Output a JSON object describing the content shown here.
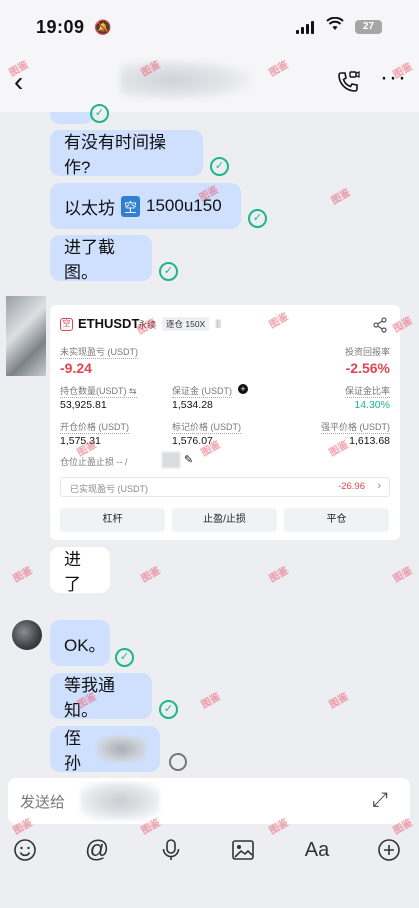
{
  "status_bar": {
    "time": "19:09",
    "battery": "27"
  },
  "header": {
    "back_icon": "chevron-left-icon",
    "call_icon": "video-call-icon",
    "more_icon": "more-icon"
  },
  "messages": {
    "m1": "有没有时间操作?",
    "m2_prefix": "以太坊",
    "m2_tag": "空",
    "m2_suffix": "1500u150",
    "m3": "进了截图。",
    "m4": "进了",
    "m5": "OK。",
    "m6": "等我通知。",
    "m7": "侄孙"
  },
  "trade_card": {
    "pair": "ETHUSDT",
    "type": "永续",
    "mode": "逐仓 150X",
    "bars": "||||",
    "unrealized_label": "未实现盈亏 (USDT)",
    "unrealized_value": "-9.24",
    "roi_label": "投资回报率",
    "roi_value": "-2.56%",
    "size_label": "持仓数量(USDT) ⇆",
    "size_value": "53,925.81",
    "margin_label": "保证金 (USDT)",
    "margin_value": "1,534.28",
    "margin_ratio_label": "保证金比率",
    "margin_ratio_value": "14.30%",
    "entry_label": "开仓价格 (USDT)",
    "entry_value": "1,575.31",
    "mark_label": "标记价格 (USDT)",
    "mark_value": "1,576.07",
    "liq_label": "强平价格 (USDT)",
    "liq_value": "1,613.68",
    "tpsl_label": "仓位止盈止损 -- /",
    "realized_label": "已实现盈亏 (USDT)",
    "realized_value": "-26.96",
    "btn_leverage": "杠杆",
    "btn_tpsl": "止盈/止损",
    "btn_close": "平仓"
  },
  "input": {
    "placeholder": "发送给"
  },
  "toolbar": {
    "emoji": "emoji-icon",
    "mention": "mention-icon",
    "voice": "microphone-icon",
    "image": "image-icon",
    "font": "Aa",
    "add": "add-icon"
  },
  "watermark": "图鉴",
  "colors": {
    "bubble": "#cfe0ff",
    "check": "#1fb58b",
    "loss": "#e0464f",
    "gain": "#1fb58b"
  }
}
